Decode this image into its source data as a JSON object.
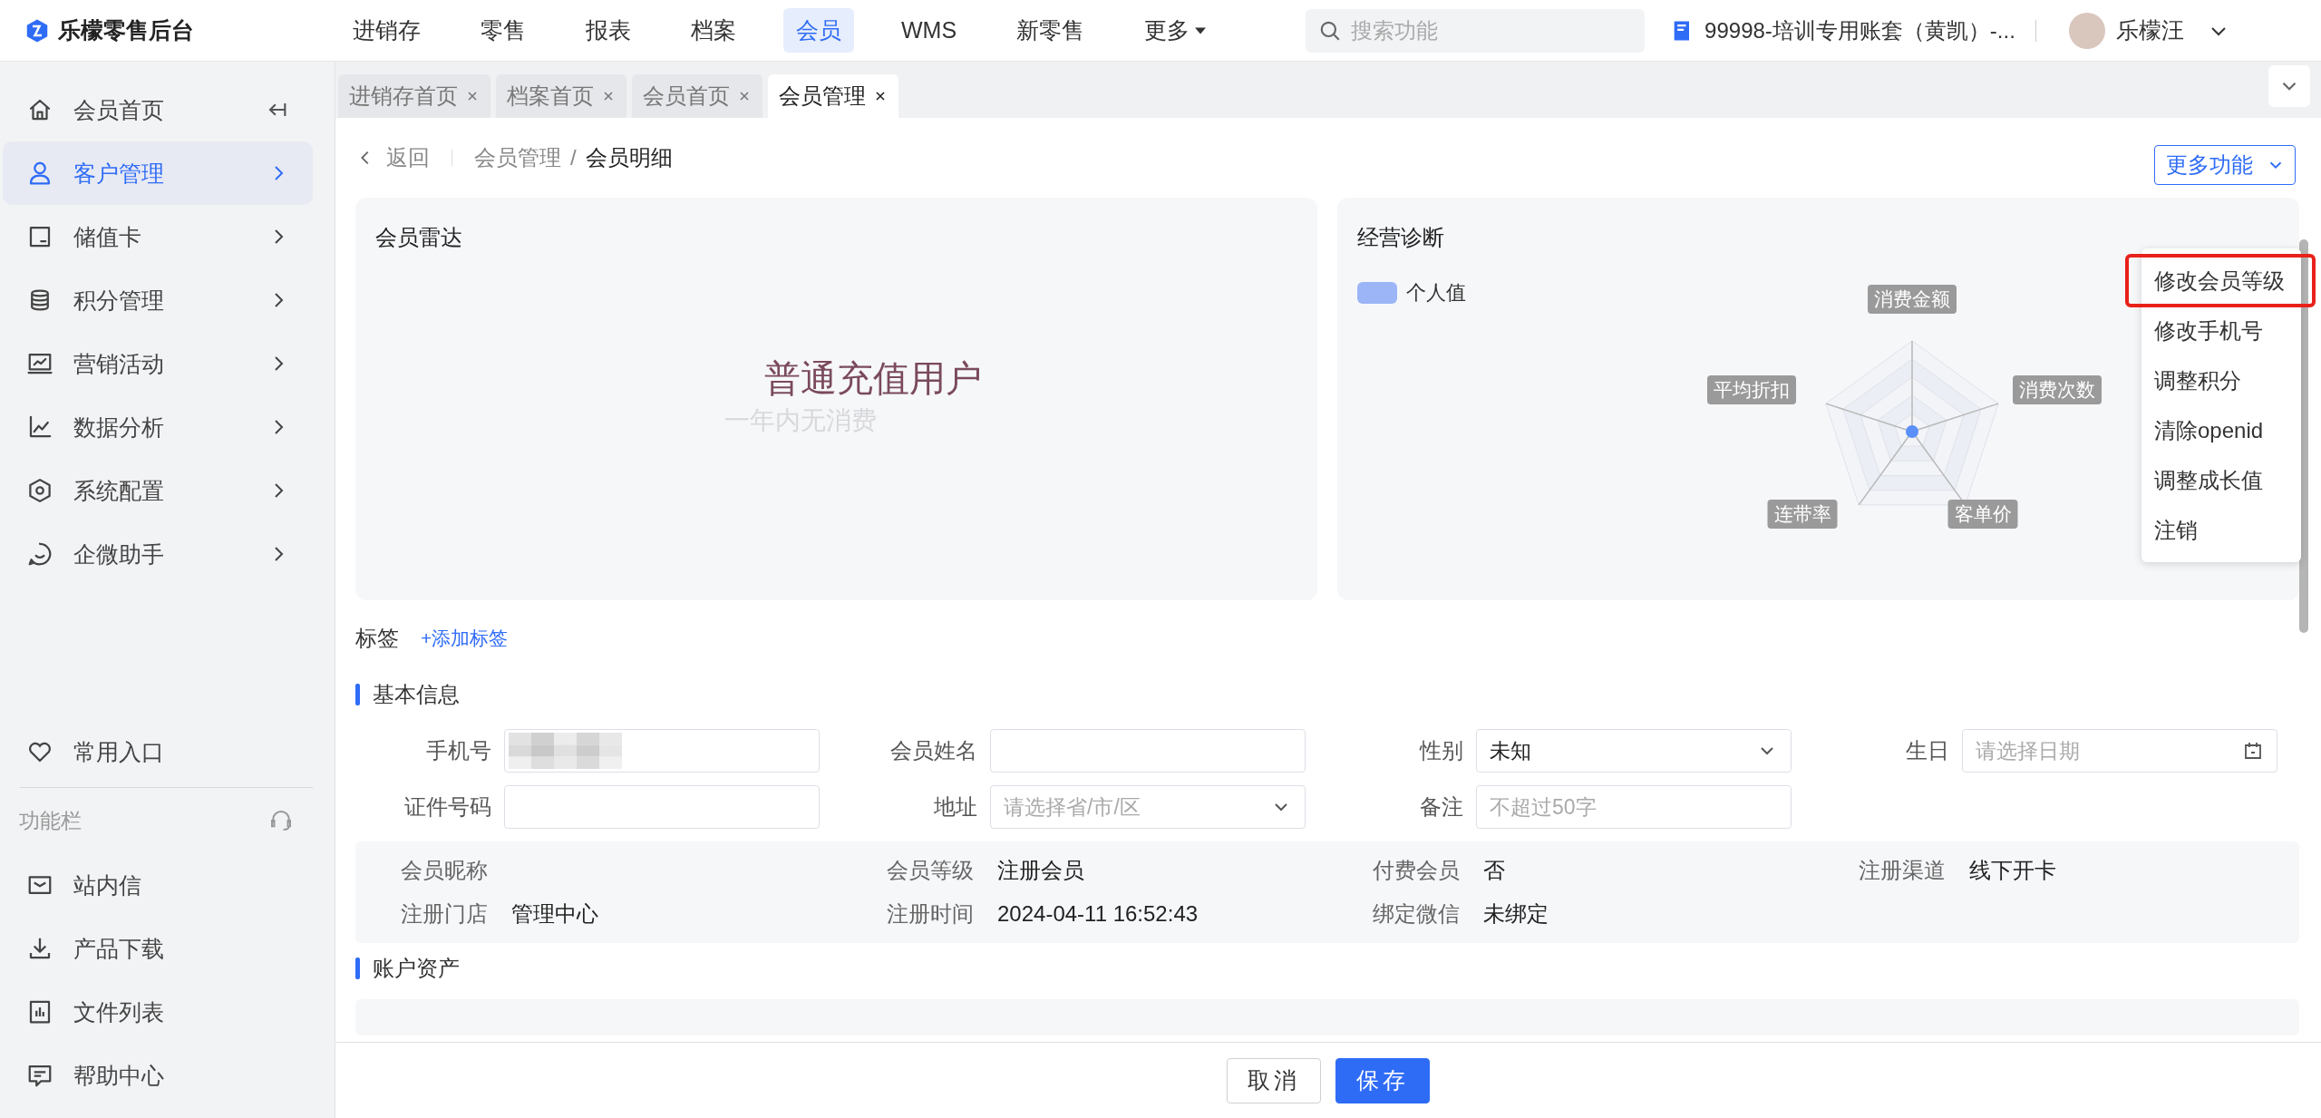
{
  "brand": {
    "name": "乐檬零售后台"
  },
  "top_nav": [
    {
      "label": "进销存",
      "selected": false,
      "dropdown": false
    },
    {
      "label": "零售",
      "selected": false,
      "dropdown": false
    },
    {
      "label": "报表",
      "selected": false,
      "dropdown": false
    },
    {
      "label": "档案",
      "selected": false,
      "dropdown": false
    },
    {
      "label": "会员",
      "selected": true,
      "dropdown": false
    },
    {
      "label": "WMS",
      "selected": false,
      "dropdown": false
    },
    {
      "label": "新零售",
      "selected": false,
      "dropdown": false
    },
    {
      "label": "更多",
      "selected": false,
      "dropdown": true
    }
  ],
  "search": {
    "placeholder": "搜索功能"
  },
  "account": {
    "label": "99998-培训专用账套（黄凯）-..."
  },
  "user": {
    "name": "乐檬汪"
  },
  "sidebar": {
    "items": [
      {
        "label": "会员首页",
        "kind": "home",
        "selected": false
      },
      {
        "label": "客户管理",
        "kind": "menu",
        "selected": true
      },
      {
        "label": "储值卡",
        "kind": "menu",
        "selected": false
      },
      {
        "label": "积分管理",
        "kind": "menu",
        "selected": false
      },
      {
        "label": "营销活动",
        "kind": "menu",
        "selected": false
      },
      {
        "label": "数据分析",
        "kind": "menu",
        "selected": false
      },
      {
        "label": "系统配置",
        "kind": "menu",
        "selected": false
      },
      {
        "label": "企微助手",
        "kind": "menu",
        "selected": false
      }
    ],
    "favorites": {
      "label": "常用入口"
    },
    "function_bar": {
      "label": "功能栏"
    },
    "bottom_items": [
      {
        "label": "站内信"
      },
      {
        "label": "产品下载"
      },
      {
        "label": "文件列表"
      },
      {
        "label": "帮助中心"
      }
    ]
  },
  "tabs": [
    {
      "label": "进销存首页",
      "selected": false
    },
    {
      "label": "档案首页",
      "selected": false
    },
    {
      "label": "会员首页",
      "selected": false
    },
    {
      "label": "会员管理",
      "selected": true
    }
  ],
  "breadcrumb": {
    "back": "返回",
    "separator": "/",
    "items": [
      "会员管理",
      "会员明细"
    ]
  },
  "more_button": {
    "label": "更多功能"
  },
  "more_menu": [
    {
      "label": "修改会员等级",
      "highlighted": true
    },
    {
      "label": "修改手机号",
      "highlighted": false
    },
    {
      "label": "调整积分",
      "highlighted": false
    },
    {
      "label": "清除openid",
      "highlighted": false
    },
    {
      "label": "调整成长值",
      "highlighted": false
    },
    {
      "label": "注销",
      "highlighted": false
    }
  ],
  "radar_card": {
    "title": "会员雷达",
    "headline": "普通充值用户",
    "subtext": "一年内无消费"
  },
  "diagnosis_card": {
    "title": "经营诊断",
    "legend": {
      "label": "个人值",
      "color": "#9bb5f7"
    },
    "indicators": [
      "消费金额",
      "消费次数",
      "客单价",
      "连带率",
      "平均折扣"
    ]
  },
  "tags": {
    "label": "标签",
    "add_link": "+添加标签"
  },
  "basic_info": {
    "title": "基本信息",
    "fields": [
      {
        "label": "手机号",
        "kind": "text",
        "redacted": true
      },
      {
        "label": "会员姓名",
        "kind": "text"
      },
      {
        "label": "性别",
        "kind": "select",
        "value": "未知"
      },
      {
        "label": "生日",
        "kind": "date",
        "placeholder": "请选择日期"
      },
      {
        "label": "证件号码",
        "kind": "text"
      },
      {
        "label": "地址",
        "kind": "select",
        "placeholder": "请选择省/市/区"
      },
      {
        "label": "备注",
        "kind": "text",
        "placeholder": "不超过50字"
      }
    ]
  },
  "info": [
    {
      "label": "会员昵称"
    },
    {
      "label": "会员等级",
      "value": "注册会员"
    },
    {
      "label": "付费会员",
      "value": "否"
    },
    {
      "label": "注册渠道",
      "value": "线下开卡"
    },
    {
      "label": "注册门店",
      "value": "管理中心"
    },
    {
      "label": "注册时间",
      "value": "2024-04-11 16:52:43"
    },
    {
      "label": "绑定微信",
      "value": "未绑定"
    }
  ],
  "account_assets": {
    "title": "账户资产"
  },
  "footer": {
    "cancel": "取消",
    "save": "保存"
  }
}
